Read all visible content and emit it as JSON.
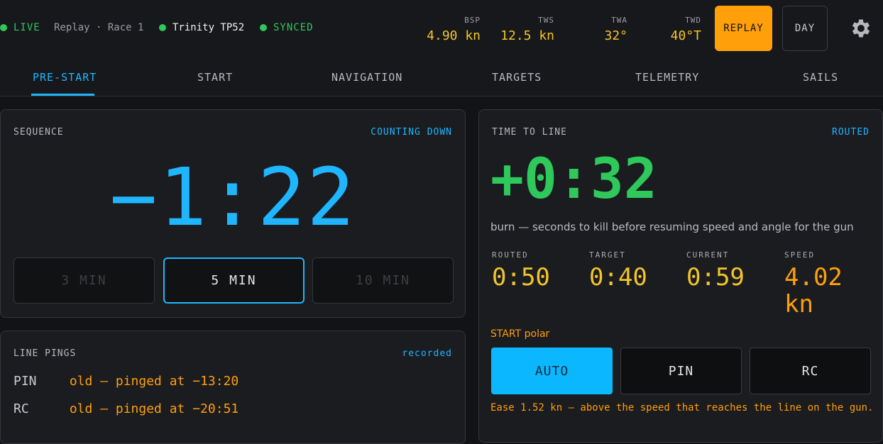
{
  "status": {
    "live": "LIVE",
    "mode": "Replay · Race 1",
    "boat": "Trinity TP52",
    "sync": "SYNCED"
  },
  "metrics": [
    {
      "label": "BSP",
      "value": "4.90 kn"
    },
    {
      "label": "TWS",
      "value": "12.5 kn"
    },
    {
      "label": "TWA",
      "value": "32°"
    },
    {
      "label": "TWD",
      "value": "40°T"
    }
  ],
  "buttons": {
    "replay": "REPLAY",
    "day": "DAY"
  },
  "icons": {
    "settings": "gear-icon"
  },
  "tabs": [
    "PRE-START",
    "START",
    "NAVIGATION",
    "TARGETS",
    "TELEMETRY",
    "SAILS"
  ],
  "active_tab": "PRE-START",
  "sequence": {
    "label": "SEQUENCE",
    "status": "COUNTING DOWN",
    "countdown": "−1:22",
    "options": [
      "3 MIN",
      "5 MIN",
      "10 MIN"
    ],
    "selected": "5 MIN"
  },
  "line_pings": {
    "label": "LINE PINGS",
    "status": "recorded",
    "rows": [
      {
        "key": "PIN",
        "value": "old — pinged at −13:20"
      },
      {
        "key": "RC",
        "value": "old — pinged at −20:51"
      }
    ]
  },
  "time_to_line": {
    "label": "TIME TO LINE",
    "status": "ROUTED",
    "value": "+0:32",
    "description": "burn — seconds to kill before resuming speed and angle for the gun",
    "stats": [
      {
        "label": "ROUTED",
        "value": "0:50"
      },
      {
        "label": "TARGET",
        "value": "0:40"
      },
      {
        "label": "CURRENT",
        "value": "0:59"
      },
      {
        "label": "SPEED",
        "value": "4.02 kn"
      }
    ],
    "polar_label": "START polar",
    "polar_options": [
      "AUTO",
      "PIN",
      "RC"
    ],
    "polar_selected": "AUTO",
    "ease": "Ease 1.52 kn — above the speed that reaches the line on the gun."
  },
  "colors": {
    "accent": "#1fb6ff",
    "live": "#2ec85b",
    "warning": "#ff9f0a",
    "value": "#f3c529"
  }
}
